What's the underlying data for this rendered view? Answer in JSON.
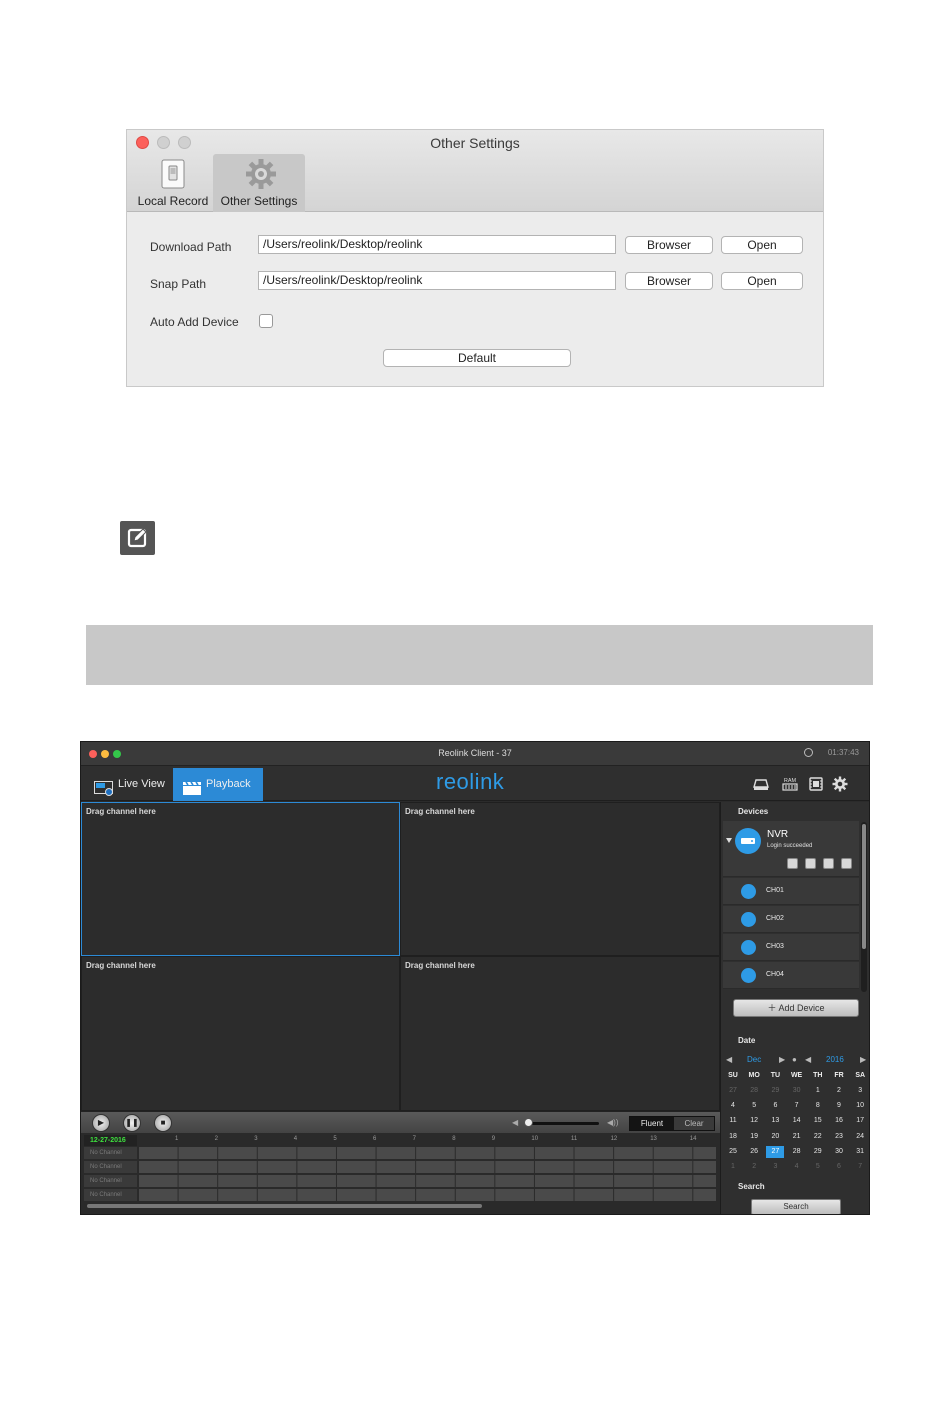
{
  "settings_window": {
    "title": "Other Settings",
    "tabs": [
      {
        "label": "Local Record",
        "icon": "switch-icon"
      },
      {
        "label": "Other Settings",
        "icon": "gear-icon"
      }
    ],
    "download_path": {
      "label": "Download Path",
      "value": "/Users/reolink/Desktop/reolink",
      "browse_label": "Browser",
      "open_label": "Open"
    },
    "snap_path": {
      "label": "Snap Path",
      "value": "/Users/reolink/Desktop/reolink",
      "browse_label": "Browser",
      "open_label": "Open"
    },
    "auto_add_device": {
      "label": "Auto Add Device",
      "checked": false
    },
    "default_label": "Default",
    "colors": {
      "close": "#fc605b"
    }
  },
  "edit_icon": {
    "icon": "edit-icon"
  },
  "client": {
    "title": "Reolink Client - 37",
    "clock": "01:37:43",
    "logo": "reolink",
    "tabs": [
      {
        "label": "Live View",
        "icon": "live-view-icon"
      },
      {
        "label": "Playback",
        "icon": "clapper-icon",
        "active": true
      }
    ],
    "toolbar_icons": [
      "hdd-icon",
      "ram-icon",
      "film-icon",
      "gear-icon"
    ],
    "ram_text": "RAM",
    "panes": [
      "Drag channel here",
      "Drag channel here",
      "Drag channel here",
      "Drag channel here"
    ],
    "controls": {
      "fluent_label": "Fluent",
      "clear_label": "Clear",
      "volume": 0.0
    },
    "timeline": {
      "date": "12-27-2016",
      "hours": [
        "1",
        "2",
        "3",
        "4",
        "5",
        "6",
        "7",
        "8",
        "9",
        "10",
        "11",
        "12",
        "13",
        "14"
      ],
      "rows": [
        "No Channel",
        "No Channel",
        "No Channel",
        "No Channel"
      ]
    },
    "sidebar": {
      "devices_heading": "Devices",
      "nvr": {
        "name": "NVR",
        "status": "Login succeeded"
      },
      "channels": [
        "CH01",
        "CH02",
        "CH03",
        "CH04"
      ],
      "add_device_label": "Add Device",
      "date_heading": "Date",
      "month": "Dec",
      "year": "2016",
      "weekdays": [
        "SU",
        "MO",
        "TU",
        "WE",
        "TH",
        "FR",
        "SA"
      ],
      "calendar": [
        [
          "27",
          "28",
          "29",
          "30",
          "1",
          "2",
          "3"
        ],
        [
          "4",
          "5",
          "6",
          "7",
          "8",
          "9",
          "10"
        ],
        [
          "11",
          "12",
          "13",
          "14",
          "15",
          "16",
          "17"
        ],
        [
          "18",
          "19",
          "20",
          "21",
          "22",
          "23",
          "24"
        ],
        [
          "25",
          "26",
          "27",
          "28",
          "29",
          "30",
          "31"
        ],
        [
          "1",
          "2",
          "3",
          "4",
          "5",
          "6",
          "7"
        ]
      ],
      "selected_day": "27",
      "search_heading": "Search",
      "search_label": "Search"
    },
    "colors": {
      "accent": "#2c8ad6",
      "logo": "#2e9be6",
      "date_green": "#3ee03e"
    }
  }
}
